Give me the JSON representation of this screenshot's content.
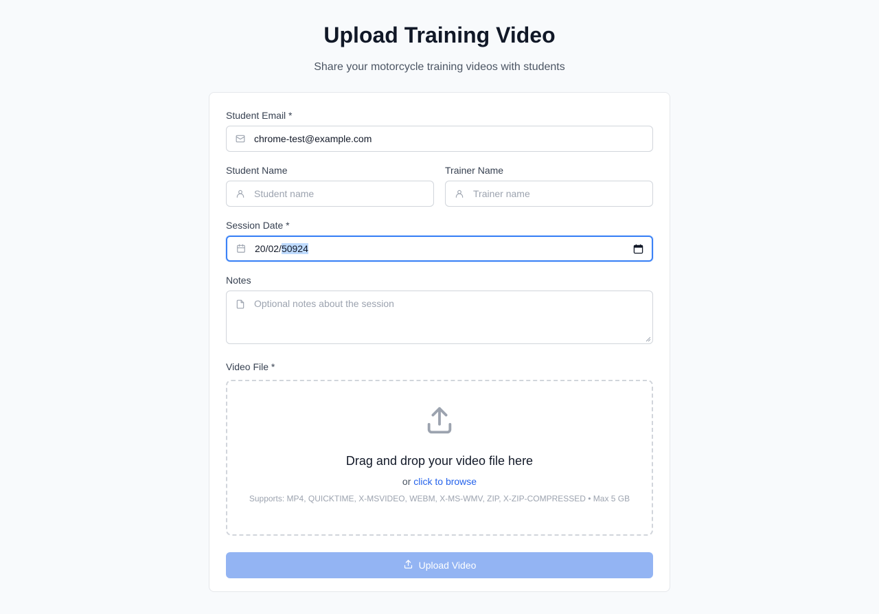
{
  "header": {
    "title": "Upload Training Video",
    "subtitle": "Share your motorcycle training videos with students"
  },
  "form": {
    "email": {
      "label": "Student Email *",
      "value": "chrome-test@example.com",
      "icon": "mail-icon"
    },
    "student_name": {
      "label": "Student Name",
      "placeholder": "Student name",
      "icon": "user-icon"
    },
    "trainer_name": {
      "label": "Trainer Name",
      "placeholder": "Trainer name",
      "icon": "user-icon"
    },
    "session_date": {
      "label": "Session Date *",
      "value_prefix": "20/02/",
      "value_selected": "50924",
      "icon": "calendar-icon"
    },
    "notes": {
      "label": "Notes",
      "placeholder": "Optional notes about the session",
      "icon": "file-icon"
    },
    "video": {
      "label": "Video File *",
      "drop_title": "Drag and drop your video file here",
      "or_text": "or ",
      "browse_text": "click to browse",
      "supports_text": "Supports: MP4, QUICKTIME, X-MSVIDEO, WEBM, X-MS-WMV, ZIP, X-ZIP-COMPRESSED • Max 5 GB",
      "icon": "upload-icon"
    },
    "submit": {
      "label": "Upload Video",
      "icon": "upload-icon",
      "disabled": true
    }
  },
  "colors": {
    "accent": "#3b82f6",
    "link": "#2563eb",
    "button_disabled": "#93b4f3",
    "background": "#f8fafc"
  }
}
